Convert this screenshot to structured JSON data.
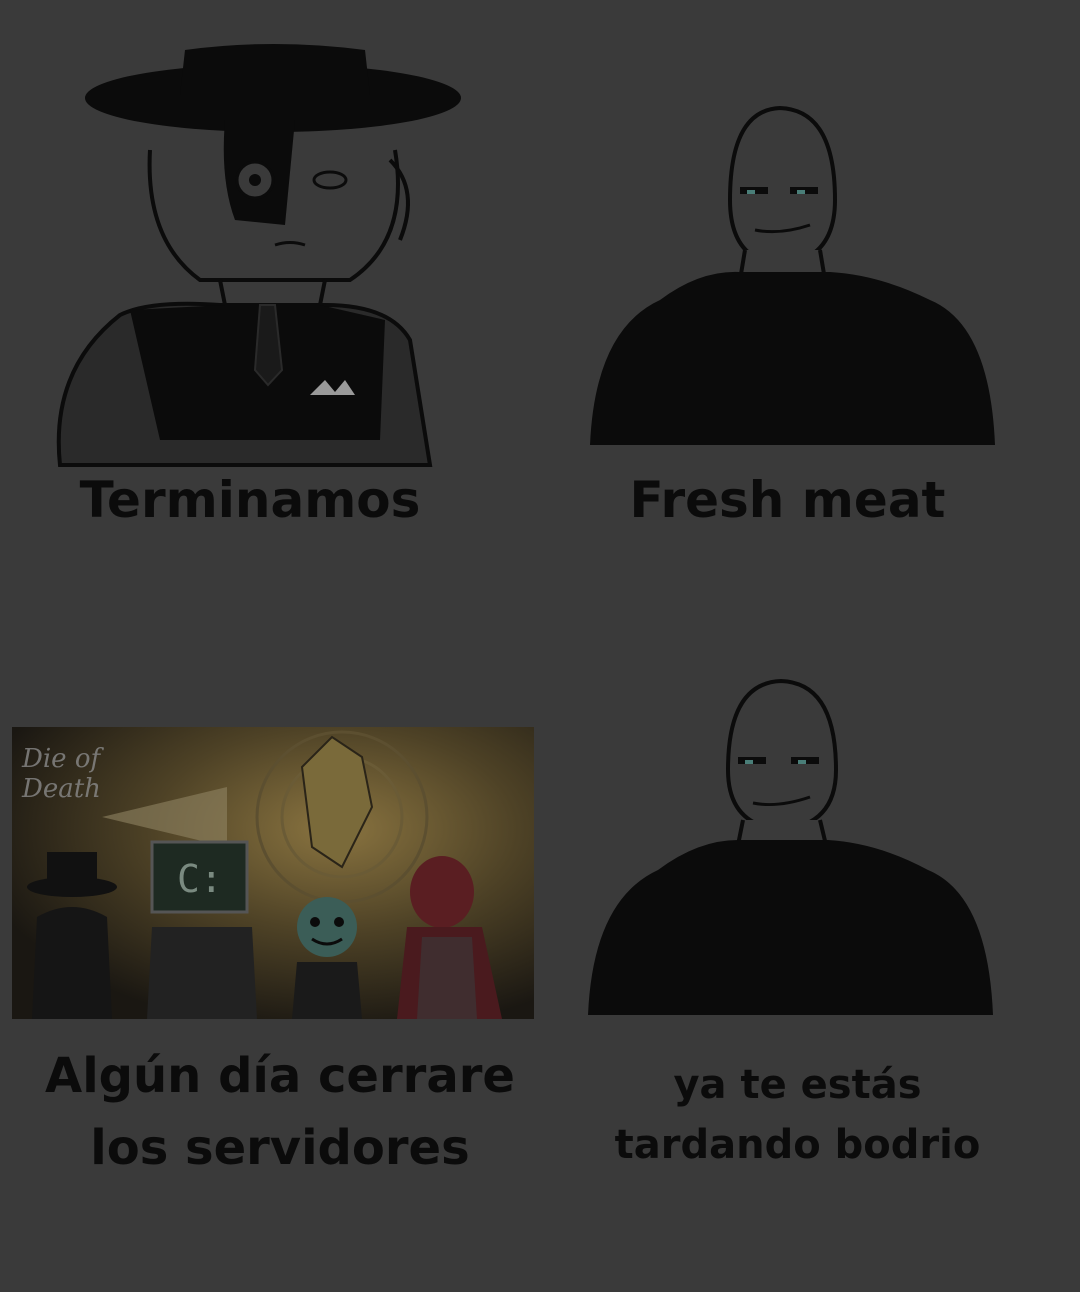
{
  "panels": [
    {
      "caption": "Terminamos",
      "figure": "woman-in-wide-brim-hat-with-half-black-face-mask"
    },
    {
      "caption": "Fresh meat",
      "figure": "muscular-bald-smiling-man"
    },
    {
      "caption": "Algún día cerrare los servidores",
      "figure": "game-scene-with-characters",
      "watermark": "Die of Death"
    },
    {
      "caption": "ya te estás tardando bodrio",
      "figure": "muscular-bald-smiling-man"
    }
  ],
  "colors": {
    "background": "#3a3a3a",
    "ink": "#0b0b0b",
    "scene_glow": "#6b5a30"
  }
}
